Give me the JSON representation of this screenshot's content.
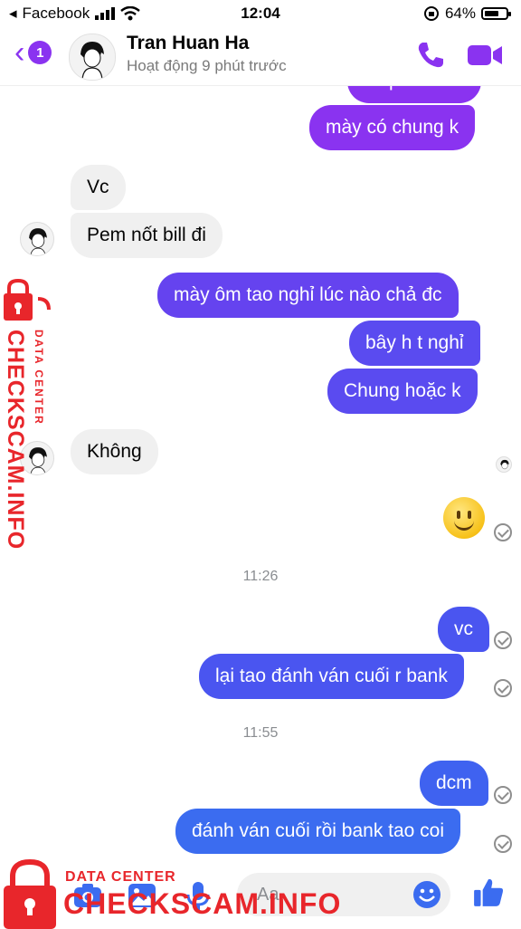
{
  "status": {
    "carrier": "Facebook",
    "time": "12:04",
    "battery": "64%"
  },
  "header": {
    "back_count": "1",
    "name": "Tran Huan Ha",
    "presence": "Hoạt động 9 phút trước"
  },
  "messages": {
    "m0": "kh pem nữa",
    "m1": "mày có chung k",
    "m2": "Vc",
    "m3": "Pem nốt bill đi",
    "m4": "mày ôm tao nghỉ lúc nào chả đc",
    "m5": "bây h t nghỉ",
    "m6": "Chung hoặc k",
    "m7": "Không",
    "m8": "vc",
    "m9": "lại tao đánh ván cuối r bank",
    "m10": "dcm",
    "m11": "đánh ván cuối rồi bank tao coi"
  },
  "timestamps": {
    "t1": "11:26",
    "t2": "11:55"
  },
  "watermark": {
    "tag": "DATA CENTER",
    "site": "CHECKSCAM.INFO"
  },
  "composer": {
    "placeholder": "Aa"
  },
  "colors": {
    "accent": "#8a33f0",
    "bubble_top": "#8a33f0",
    "bubble_bottom": "#3b6cf0",
    "watermark": "#e8262b"
  },
  "icons": [
    "chevron-left-icon",
    "phone-icon",
    "video-camera-icon",
    "checkmark-circle-icon",
    "camera-icon",
    "image-icon",
    "microphone-icon",
    "emoji-icon",
    "thumbs-up-icon",
    "lock-icon"
  ]
}
